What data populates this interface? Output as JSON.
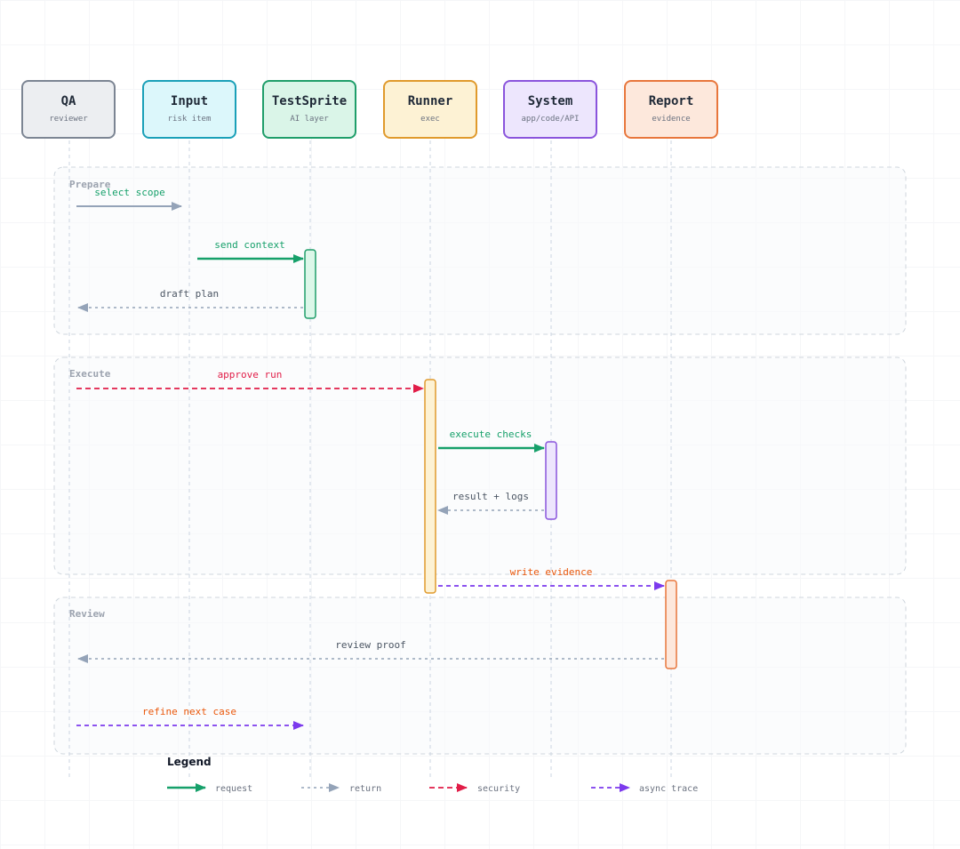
{
  "actors": [
    {
      "name": "QA",
      "sub": "reviewer"
    },
    {
      "name": "Input",
      "sub": "risk item"
    },
    {
      "name": "TestSprite",
      "sub": "AI layer"
    },
    {
      "name": "Runner",
      "sub": "exec"
    },
    {
      "name": "System",
      "sub": "app/code/API"
    },
    {
      "name": "Report",
      "sub": "evidence"
    }
  ],
  "groups": {
    "prepare": "Prepare",
    "execute": "Execute",
    "review": "Review"
  },
  "messages": {
    "select_scope": "select scope",
    "send_context": "send context",
    "draft_plan": "draft plan",
    "approve_run": "approve run",
    "execute_checks": "execute checks",
    "result_logs": "result + logs",
    "write_evidence": "write evidence",
    "review_proof": "review proof",
    "refine_next_case": "refine next case"
  },
  "legend": {
    "title": "Legend",
    "request": "request",
    "return": "return",
    "security": "security",
    "async": "async trace"
  },
  "colors": {
    "request": "#16a06a",
    "return": "#94a3b8",
    "security": "#e11d48",
    "async": "#7c3aed",
    "async_label": "#ea580c",
    "return_label": "#4b5563"
  }
}
